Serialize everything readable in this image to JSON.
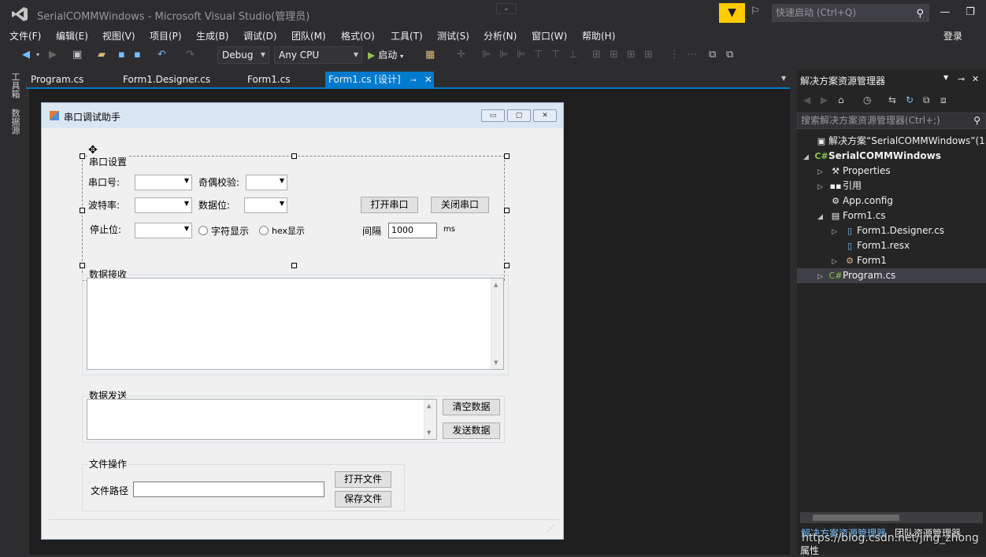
{
  "titlebar": {
    "title": "SerialCOMMWindows - Microsoft Visual Studio(管理员)",
    "quick_launch_placeholder": "快速启动 (Ctrl+Q)"
  },
  "menubar": {
    "items": [
      "文件(F)",
      "编辑(E)",
      "视图(V)",
      "项目(P)",
      "生成(B)",
      "调试(D)",
      "团队(M)",
      "格式(O)",
      "工具(T)",
      "测试(S)",
      "分析(N)",
      "窗口(W)",
      "帮助(H)"
    ],
    "login": "登录"
  },
  "toolbar": {
    "config": "Debug",
    "platform": "Any CPU",
    "start": "启动"
  },
  "left_tabs": [
    "工具箱",
    "数据源"
  ],
  "tabs": [
    "Program.cs",
    "Form1.Designer.cs",
    "Form1.cs",
    "Form1.cs [设计]"
  ],
  "form": {
    "title": "串口调试助手",
    "serial_group": "串口设置",
    "port_label": "串口号:",
    "parity_label": "奇偶校验:",
    "baud_label": "波特率:",
    "databits_label": "数据位:",
    "stopbits_label": "停止位:",
    "open_port": "打开串口",
    "close_port": "关闭串口",
    "char_display": "字符显示",
    "hex_display": "hex显示",
    "interval_label": "间隔",
    "interval_value": "1000",
    "interval_unit": "ms",
    "receive_group": "数据接收",
    "send_group": "数据发送",
    "clear_data": "清空数据",
    "send_data": "发送数据",
    "file_group": "文件操作",
    "file_path_label": "文件路径",
    "open_file": "打开文件",
    "save_file": "保存文件"
  },
  "solution_explorer": {
    "title": "解决方案资源管理器",
    "search_placeholder": "搜索解决方案资源管理器(Ctrl+;)",
    "items": [
      {
        "label": "解决方案“SerialCOMMWindows”(1"
      },
      {
        "label": "SerialCOMMWindows"
      },
      {
        "label": "Properties"
      },
      {
        "label": "引用"
      },
      {
        "label": "App.config"
      },
      {
        "label": "Form1.cs"
      },
      {
        "label": "Form1.Designer.cs"
      },
      {
        "label": "Form1.resx"
      },
      {
        "label": "Form1"
      },
      {
        "label": "Program.cs"
      }
    ],
    "bottom_tabs": [
      "解决方案资源管理器",
      "团队资源管理器"
    ],
    "properties_label": "属性"
  },
  "watermark": "https://blog.csdn.net/jing_zhong",
  "colors": {
    "accent": "#007acc",
    "background": "#2d2d30",
    "form_bg": "#f0f0f0"
  }
}
